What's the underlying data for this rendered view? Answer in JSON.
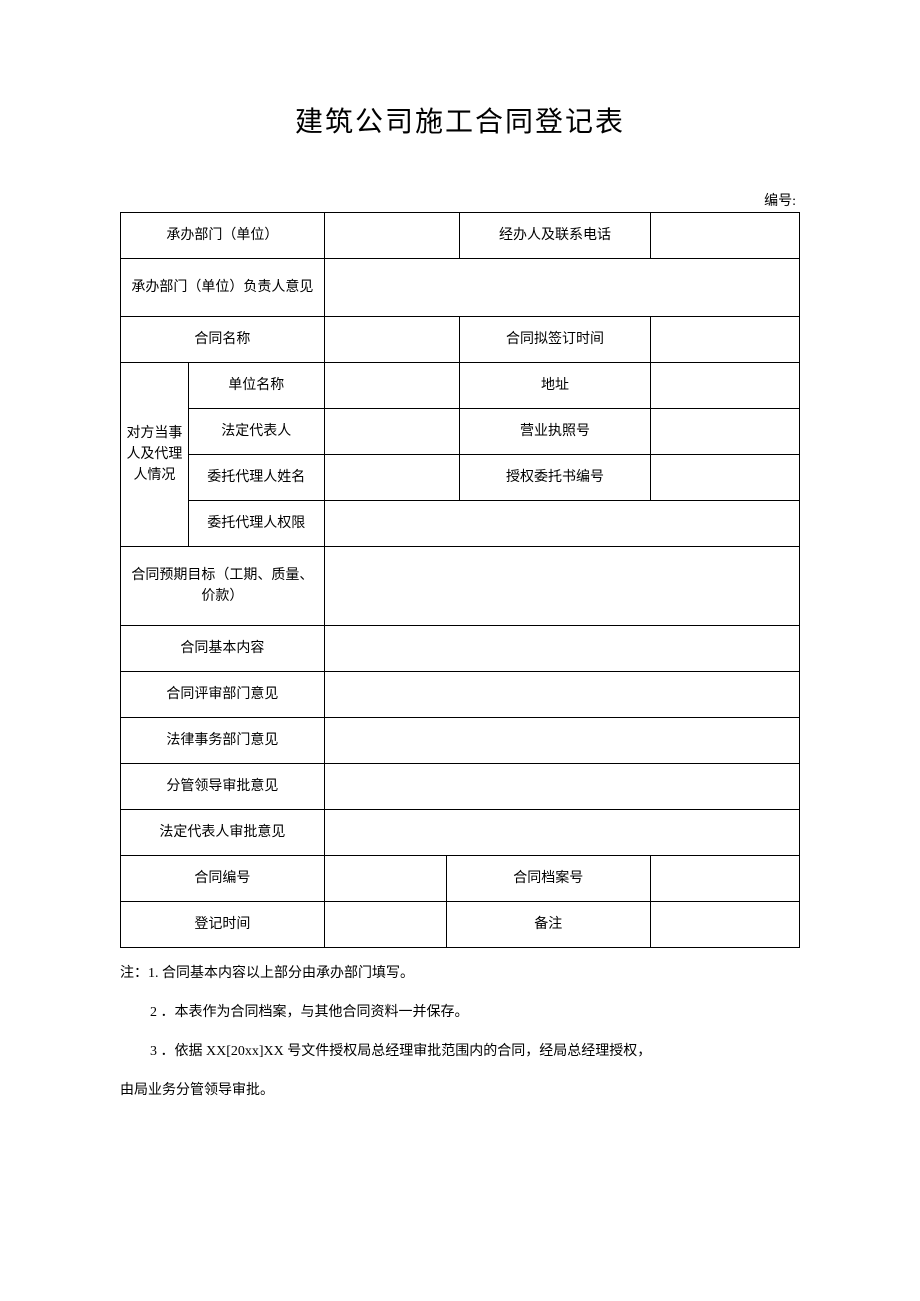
{
  "title": "建筑公司施工合同登记表",
  "docNumberLabel": "编号:",
  "rows": {
    "dept": "承办部门（单位）",
    "handler": "经办人及联系电话",
    "deptOpinion": "承办部门（单位）负责人意见",
    "contractName": "合同名称",
    "signTime": "合同拟签订时间",
    "partyHeader": "对方当事人及代理人情况",
    "unitName": "单位名称",
    "address": "地址",
    "legalRep": "法定代表人",
    "licenseNo": "营业执照号",
    "agentName": "委托代理人姓名",
    "authNo": "授权委托书编号",
    "agentScope": "委托代理人权限",
    "expectedTarget": "合同预期目标（工期、质量、价款）",
    "basicContent": "合同基本内容",
    "reviewOpinion": "合同评审部门意见",
    "legalOpinion": "法律事务部门意见",
    "leaderOpinion": "分管领导审批意见",
    "repOpinion": "法定代表人审批意见",
    "contractNo": "合同编号",
    "archiveNo": "合同档案号",
    "registerTime": "登记时间",
    "remark": "备注"
  },
  "notes": {
    "prefix": "注：",
    "n1": "1. 合同基本内容以上部分由承办部门填写。",
    "n2": "2 ．本表作为合同档案，与其他合同资料一并保存。",
    "n3": "3 ．依据 XX[20xx]XX 号文件授权局总经理审批范围内的合同，经局总经理授权，",
    "n4": "由局业务分管领导审批。"
  }
}
